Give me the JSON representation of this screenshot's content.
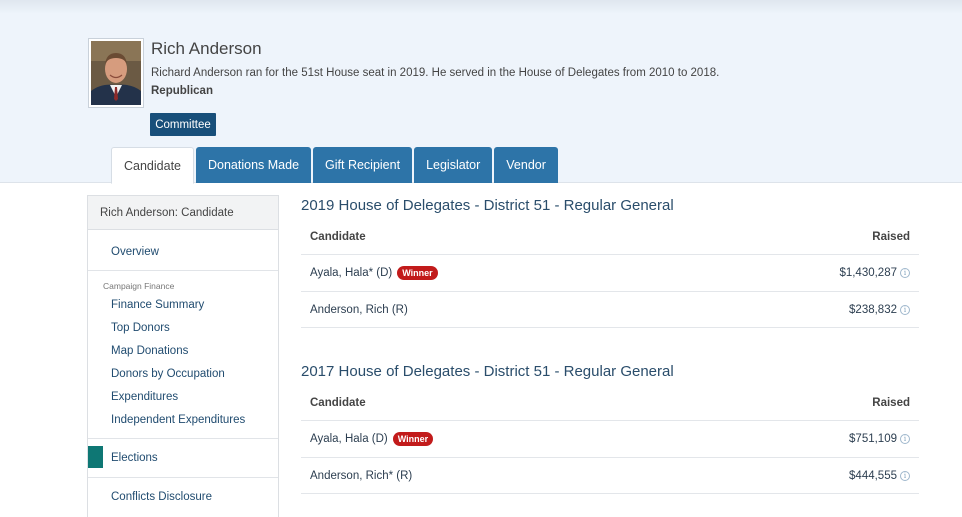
{
  "profile": {
    "name": "Rich Anderson",
    "bio": "Richard Anderson ran for the 51st House seat in 2019. He served in the House of Delegates from 2010 to 2018.",
    "party": "Republican",
    "committee_label": "Committee"
  },
  "tabs": [
    {
      "label": "Candidate",
      "active": true
    },
    {
      "label": "Donations Made",
      "active": false
    },
    {
      "label": "Gift Recipient",
      "active": false
    },
    {
      "label": "Legislator",
      "active": false
    },
    {
      "label": "Vendor",
      "active": false
    }
  ],
  "sidebar": {
    "header": "Rich Anderson: Candidate",
    "overview": "Overview",
    "category": "Campaign Finance",
    "finance_items": [
      "Finance Summary",
      "Top Donors",
      "Map Donations",
      "Donors by Occupation",
      "Expenditures",
      "Independent Expenditures"
    ],
    "elections": "Elections",
    "conflicts": "Conflicts Disclosure",
    "accent_color": "#0e7774"
  },
  "races": [
    {
      "title": "2019 House of Delegates - District 51 - Regular General",
      "col_candidate": "Candidate",
      "col_raised": "Raised",
      "rows": [
        {
          "name": "Ayala, Hala* (D)",
          "winner": "Winner",
          "raised": "$1,430,287"
        },
        {
          "name": "Anderson, Rich (R)",
          "winner": "",
          "raised": "$238,832"
        }
      ]
    },
    {
      "title": "2017 House of Delegates - District 51 - Regular General",
      "col_candidate": "Candidate",
      "col_raised": "Raised",
      "rows": [
        {
          "name": "Ayala, Hala (D)",
          "winner": "Winner",
          "raised": "$751,109"
        },
        {
          "name": "Anderson, Rich* (R)",
          "winner": "",
          "raised": "$444,555"
        }
      ]
    }
  ],
  "icons": {
    "info": "info-icon",
    "photo": "candidate-photo"
  },
  "colors": {
    "tab_bg": "#2d74a8",
    "committee_bg": "#184f7a",
    "winner_badge": "#c21b1b",
    "hero_bg": "#eef4fb"
  }
}
